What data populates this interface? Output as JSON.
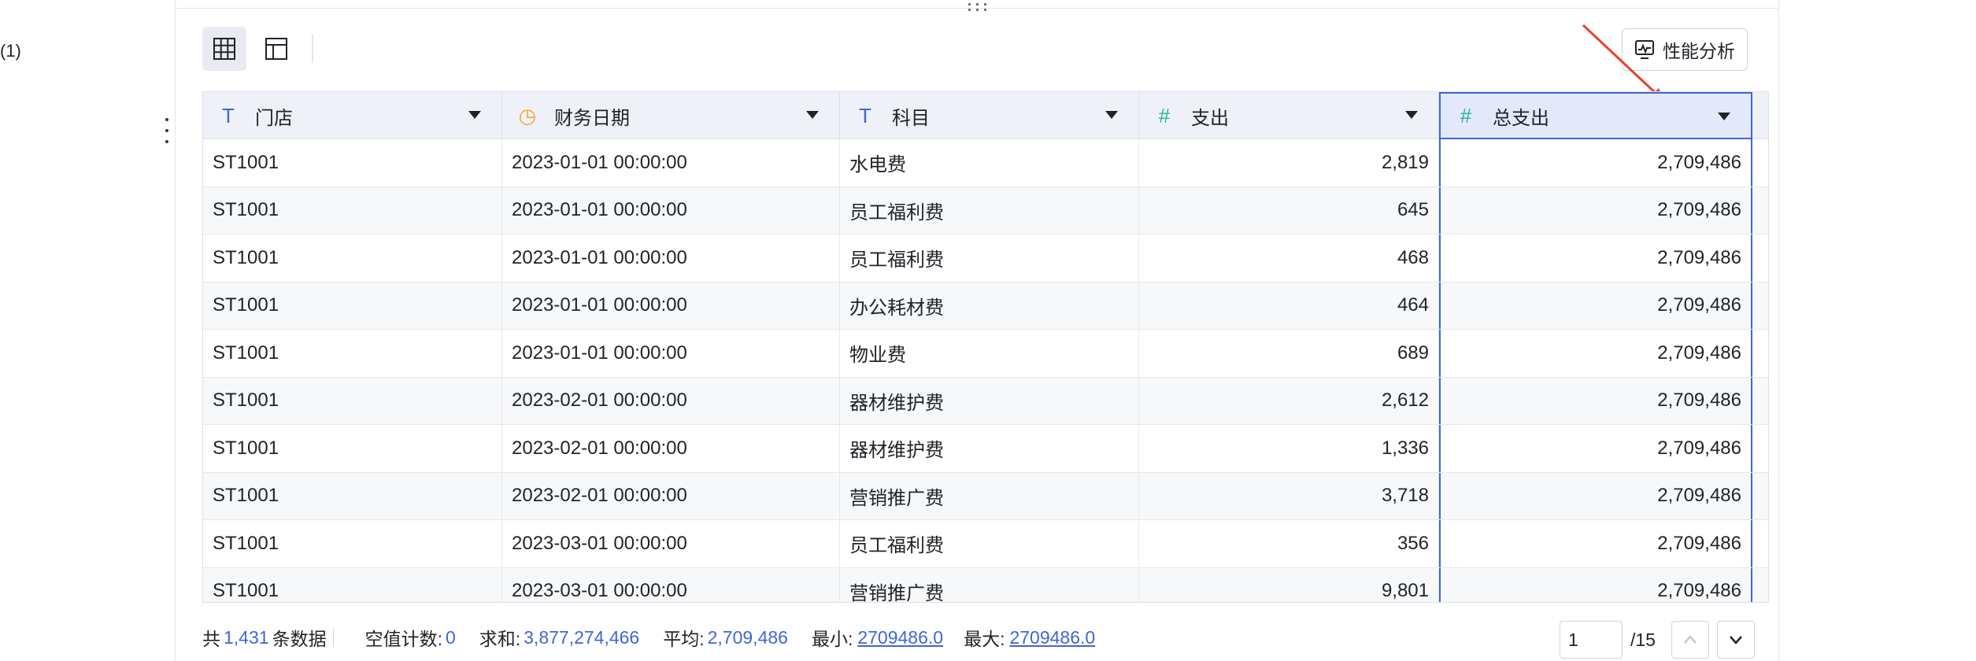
{
  "side": {
    "label": "(1)"
  },
  "toolbar": {
    "views": [
      {
        "name": "table-view",
        "icon": "table-grid-icon",
        "active": true
      },
      {
        "name": "layout-view",
        "icon": "layout-panel-icon",
        "active": false
      }
    ],
    "perf_label": "性能分析",
    "perf_icon": "performance-chart-icon"
  },
  "table": {
    "columns": [
      {
        "label": "门店",
        "type_icon": "text-type-icon",
        "glyph": "T",
        "color": "#3f66d9"
      },
      {
        "label": "财务日期",
        "type_icon": "date-type-icon",
        "glyph": "◷",
        "color": "#f5a623"
      },
      {
        "label": "科目",
        "type_icon": "text-type-icon",
        "glyph": "T",
        "color": "#3f66d9"
      },
      {
        "label": "支出",
        "type_icon": "number-type-icon",
        "glyph": "#",
        "color": "#2bb596"
      },
      {
        "label": "总支出",
        "type_icon": "number-type-icon",
        "glyph": "#",
        "color": "#2bb596"
      }
    ],
    "rows": [
      [
        "ST1001",
        "2023-01-01 00:00:00",
        "水电费",
        "2,819",
        "2,709,486"
      ],
      [
        "ST1001",
        "2023-01-01 00:00:00",
        "员工福利费",
        "645",
        "2,709,486"
      ],
      [
        "ST1001",
        "2023-01-01 00:00:00",
        "员工福利费",
        "468",
        "2,709,486"
      ],
      [
        "ST1001",
        "2023-01-01 00:00:00",
        "办公耗材费",
        "464",
        "2,709,486"
      ],
      [
        "ST1001",
        "2023-01-01 00:00:00",
        "物业费",
        "689",
        "2,709,486"
      ],
      [
        "ST1001",
        "2023-02-01 00:00:00",
        "器材维护费",
        "2,612",
        "2,709,486"
      ],
      [
        "ST1001",
        "2023-02-01 00:00:00",
        "器材维护费",
        "1,336",
        "2,709,486"
      ],
      [
        "ST1001",
        "2023-02-01 00:00:00",
        "营销推广费",
        "3,718",
        "2,709,486"
      ],
      [
        "ST1001",
        "2023-03-01 00:00:00",
        "员工福利费",
        "356",
        "2,709,486"
      ],
      [
        "ST1001",
        "2023-03-01 00:00:00",
        "营销推广费",
        "9,801",
        "2,709,486"
      ]
    ]
  },
  "footer": {
    "total_prefix": "共",
    "total_count": "1,431",
    "total_suffix": "条数据",
    "null_label": "空值计数:",
    "null_value": "0",
    "sum_label": "求和:",
    "sum_value": "3,877,274,466",
    "avg_label": "平均:",
    "avg_value": "2,709,486",
    "min_label": "最小:",
    "min_value": "2709486.0",
    "max_label": "最大:",
    "max_value": "2709486.0"
  },
  "pager": {
    "current": "1",
    "total": "/15"
  },
  "colors": {
    "accent": "#3f66d9",
    "annotation_arrow": "#e8412c"
  }
}
